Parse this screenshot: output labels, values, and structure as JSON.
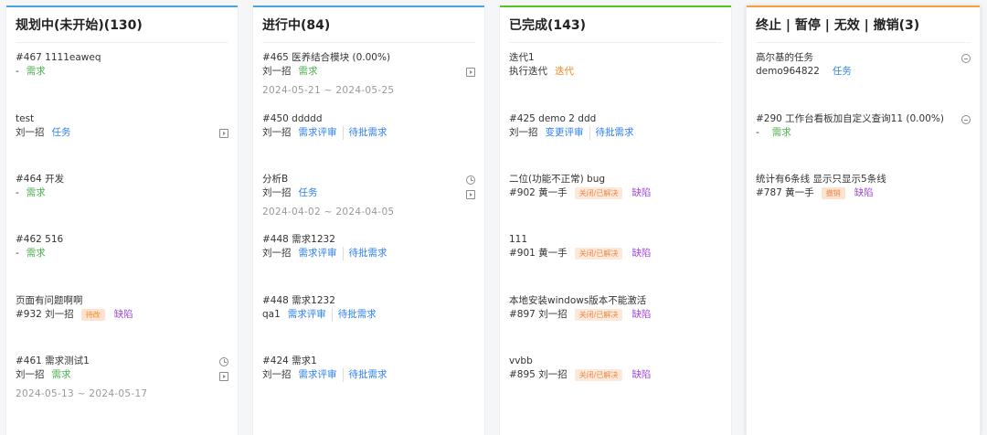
{
  "colors": {
    "planned": "#4aa3df",
    "in_progress": "#4aa3df",
    "done": "#52c41a",
    "stopped": "#fa9f3c",
    "demand": "#4caf50",
    "task": "#2f80ed",
    "iteration": "#f08a24",
    "bug": "#a24bd8"
  },
  "columns": [
    {
      "title": "规划中(未开始)(130)",
      "cards": [
        {
          "title": "#467 1111eaweq",
          "owner": "-",
          "tags": [
            {
              "text": "需求"
            }
          ],
          "icons": []
        },
        {
          "title": "test",
          "owner": "刘一招",
          "tags": [
            {
              "text": "任务"
            }
          ],
          "icons": [
            "open-icon"
          ]
        },
        {
          "title": "#464 开发",
          "owner": "-",
          "tags": [
            {
              "text": "需求"
            }
          ],
          "icons": []
        },
        {
          "title": "#462 516",
          "owner": "-",
          "tags": [
            {
              "text": "需求"
            }
          ],
          "icons": []
        },
        {
          "title": "页面有问题啊啊",
          "owner": "#932  刘一招",
          "chip": "待改",
          "tags": [
            {
              "text": "缺陷"
            }
          ],
          "icons": []
        },
        {
          "title": "#461 需求测试1",
          "owner": "刘一招",
          "tags": [
            {
              "text": "需求"
            }
          ],
          "icons": [
            "clock-icon",
            "open-icon"
          ],
          "date": "2024-05-13 ~ 2024-05-17"
        }
      ]
    },
    {
      "title": "进行中(84)",
      "cards": [
        {
          "title": "#465 医养结合模块  (0.00%)",
          "owner": "刘一招",
          "tags": [
            {
              "text": "需求"
            }
          ],
          "icons": [
            "open-icon"
          ],
          "date": "2024-05-21 ~ 2024-05-25"
        },
        {
          "title": "#450 ddddd",
          "owner": "刘一招",
          "tags": [
            {
              "text": "需求评审"
            },
            {
              "text": "待批需求"
            }
          ],
          "icons": []
        },
        {
          "title": "分析B",
          "owner": "刘一招",
          "tags": [
            {
              "text": "任务"
            }
          ],
          "icons": [
            "clock-icon",
            "open-icon"
          ],
          "date": "2024-04-02 ~ 2024-04-05"
        },
        {
          "title": "#448 需求1232",
          "owner": "刘一招",
          "tags": [
            {
              "text": "需求评审"
            },
            {
              "text": "待批需求"
            }
          ],
          "icons": []
        },
        {
          "title": "#448 需求1232",
          "owner": "qa1",
          "tags": [
            {
              "text": "需求评审"
            },
            {
              "text": "待批需求"
            }
          ],
          "icons": []
        },
        {
          "title": "#424 需求1",
          "owner": "刘一招",
          "tags": [
            {
              "text": "需求评审"
            },
            {
              "text": "待批需求"
            }
          ],
          "icons": []
        }
      ]
    },
    {
      "title": "已完成(143)",
      "cards": [
        {
          "title": "迭代1",
          "owner": "执行迭代",
          "tags": [
            {
              "text": "迭代"
            }
          ],
          "icons": []
        },
        {
          "title": "#425 demo 2 ddd",
          "owner": "刘一招",
          "tags": [
            {
              "text": "变更评审"
            },
            {
              "text": "待批需求"
            }
          ],
          "icons": []
        },
        {
          "title": "二位(功能不正常) bug",
          "owner": "#902  黄一手",
          "chip": "关闭/已解决",
          "tags": [
            {
              "text": "缺陷"
            }
          ],
          "icons": []
        },
        {
          "title": "111",
          "owner": "#901  黄一手",
          "chip": "关闭/已解决",
          "tags": [
            {
              "text": "缺陷"
            }
          ],
          "icons": []
        },
        {
          "title": "本地安装windows版本不能激活",
          "owner": "#897  刘一招",
          "chip": "关闭/已解决",
          "tags": [
            {
              "text": "缺陷"
            }
          ],
          "icons": []
        },
        {
          "title": "vvbb",
          "owner": "#895  刘一招",
          "chip": "关闭/已解决",
          "tags": [
            {
              "text": "缺陷"
            }
          ],
          "icons": []
        }
      ]
    },
    {
      "title": "终止 | 暂停 | 无效 | 撤销(3)",
      "cards": [
        {
          "title": "高尔基的任务",
          "owner": "demo964822",
          "tags": [
            {
              "text": "任务"
            }
          ],
          "icons": [
            "minus-circle-icon"
          ]
        },
        {
          "title": "#290 工作台看板加自定义查询11  (0.00%)",
          "owner": "-",
          "tags": [
            {
              "text": "需求"
            }
          ],
          "icons": [
            "minus-circle-icon"
          ]
        },
        {
          "title": "统计有6条线 显示只显示5条线",
          "owner": "#787  黄一手",
          "chip": "撤销",
          "tags": [
            {
              "text": "缺陷"
            }
          ],
          "icons": []
        }
      ]
    }
  ]
}
